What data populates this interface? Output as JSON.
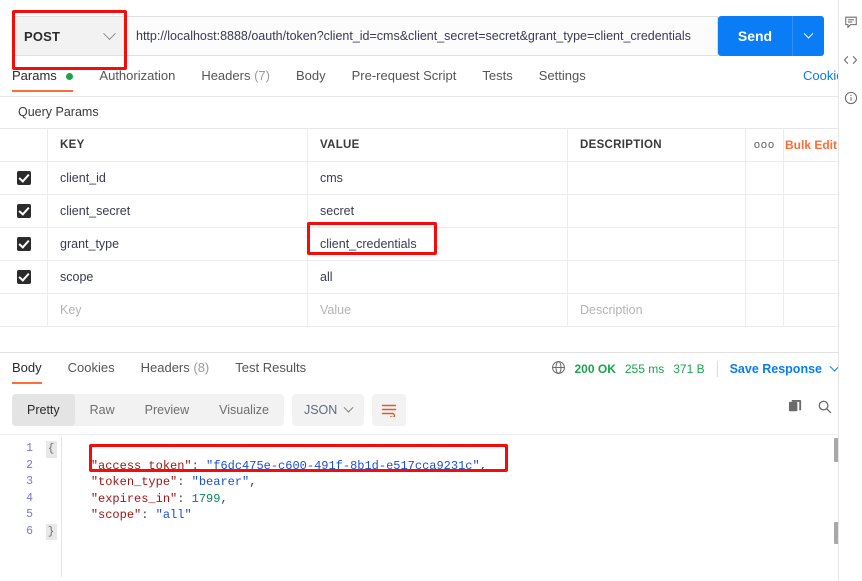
{
  "request": {
    "method": "POST",
    "url": "http://localhost:8888/oauth/token?client_id=cms&client_secret=secret&grant_type=client_credentials",
    "send_label": "Send",
    "tabs": [
      {
        "label": "Params",
        "badge": "dot",
        "active": true
      },
      {
        "label": "Authorization",
        "badge": "",
        "active": false
      },
      {
        "label": "Headers",
        "badge": "(7)",
        "active": false
      },
      {
        "label": "Body",
        "badge": "",
        "active": false
      },
      {
        "label": "Pre-request Script",
        "badge": "",
        "active": false
      },
      {
        "label": "Tests",
        "badge": "",
        "active": false
      },
      {
        "label": "Settings",
        "badge": "",
        "active": false
      }
    ],
    "cookies_link": "Cookies"
  },
  "query_params": {
    "section_title": "Query Params",
    "columns": {
      "key": "KEY",
      "value": "VALUE",
      "description": "DESCRIPTION"
    },
    "more_actions": "ooo",
    "bulk_edit": "Bulk Edit",
    "rows": [
      {
        "checked": true,
        "key": "client_id",
        "value": "cms",
        "description": ""
      },
      {
        "checked": true,
        "key": "client_secret",
        "value": "secret",
        "description": ""
      },
      {
        "checked": true,
        "key": "grant_type",
        "value": "client_credentials",
        "description": ""
      },
      {
        "checked": true,
        "key": "scope",
        "value": "all",
        "description": ""
      }
    ],
    "placeholder_row": {
      "key": "Key",
      "value": "Value",
      "description": "Description"
    }
  },
  "response": {
    "tabs": [
      {
        "label": "Body",
        "badge": "",
        "active": true
      },
      {
        "label": "Cookies",
        "badge": "",
        "active": false
      },
      {
        "label": "Headers",
        "badge": "(8)",
        "active": false
      },
      {
        "label": "Test Results",
        "badge": "",
        "active": false
      }
    ],
    "status": "200 OK",
    "time": "255 ms",
    "size": "371 B",
    "save_response": "Save Response",
    "view_modes": [
      "Pretty",
      "Raw",
      "Preview",
      "Visualize"
    ],
    "active_view_mode": "Pretty",
    "format": "JSON",
    "line_numbers": [
      "1",
      "2",
      "3",
      "4",
      "5",
      "6"
    ],
    "body_lines": [
      {
        "open": "{"
      },
      {
        "key": "\"access_token\"",
        "sep": ": ",
        "value": "\"f6dc475e-c600-491f-8b1d-e517cca9231c\"",
        "type": "string",
        "comma": ","
      },
      {
        "key": "\"token_type\"",
        "sep": ": ",
        "value": "\"bearer\"",
        "type": "string",
        "comma": ","
      },
      {
        "key": "\"expires_in\"",
        "sep": ": ",
        "value": "1799",
        "type": "number",
        "comma": ","
      },
      {
        "key": "\"scope\"",
        "sep": ": ",
        "value": "\"all\"",
        "type": "string",
        "comma": ""
      },
      {
        "close": "}"
      }
    ],
    "parsed": {
      "access_token": "f6dc475e-c600-491f-8b1d-e517cca9231c",
      "token_type": "bearer",
      "expires_in": 1799,
      "scope": "all"
    }
  },
  "annotations": [
    {
      "name": "method-highlight",
      "target": "POST"
    },
    {
      "name": "grant-type-value-highlight",
      "target": "client_credentials"
    },
    {
      "name": "access-token-highlight",
      "target": "\"access_token\": \"f6dc475e-c600-491f-8b1d-e517cca9231c\","
    }
  ],
  "right_rail_icons": [
    "comment-icon",
    "code-icon",
    "info-icon"
  ],
  "colors": {
    "accent_orange": "#ff6c37",
    "send_blue": "#0a7cf5",
    "status_green": "#1aa44b",
    "annotation_red": "#f60b0b"
  }
}
